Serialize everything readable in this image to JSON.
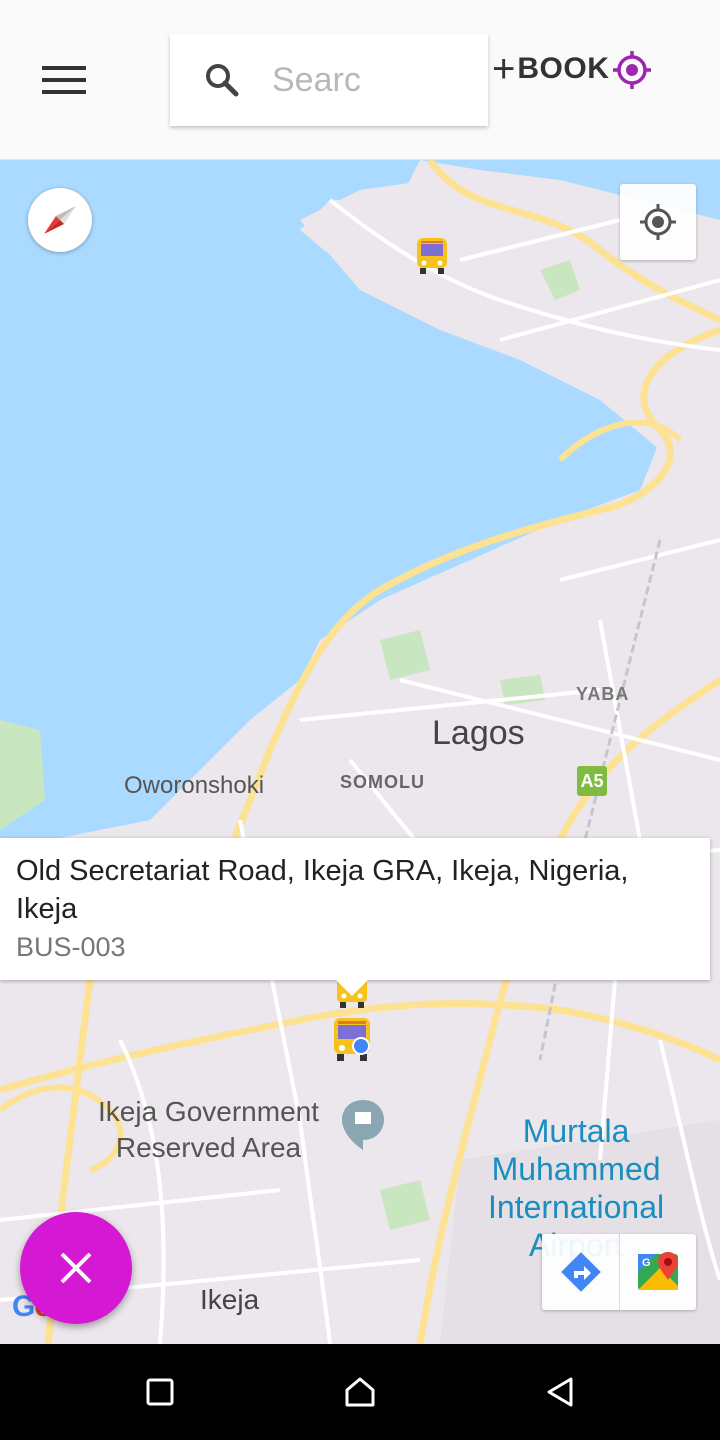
{
  "header": {
    "search_placeholder": "Searc",
    "book_plus": "+",
    "book_label": "BOOK"
  },
  "map": {
    "labels": {
      "lagos": "Lagos",
      "oworonshoki": "Oworonshoki",
      "somolu": "SOMOLU",
      "yaba": "YABA",
      "a5": "A5",
      "ikeja_gov_line1": "Ikeja Government",
      "ikeja_gov_line2": "Reserved Area",
      "murtala_line1": "Murtala",
      "murtala_line2": "Muhammed",
      "murtala_line3": "International",
      "murtala_line4": "Airport",
      "ikeja": "Ikeja",
      "google": "Google"
    },
    "info_window": {
      "address": "Old Secretariat Road, Ikeja GRA, Ikeja, Nigeria, Ikeja",
      "bus_id": "BUS-003"
    }
  },
  "icons": [
    "menu-icon",
    "search-icon",
    "target-icon",
    "compass-icon",
    "my-location-icon",
    "bus-icon",
    "close-icon",
    "directions-icon",
    "google-maps-icon",
    "recents-icon",
    "home-icon",
    "back-icon"
  ],
  "colors": {
    "accent": "#d418d4",
    "water": "#aadaff",
    "land": "#ebe7ec",
    "road_major": "#fde293",
    "bus_yellow": "#f6c21b",
    "target_purple": "#9b27b0"
  }
}
